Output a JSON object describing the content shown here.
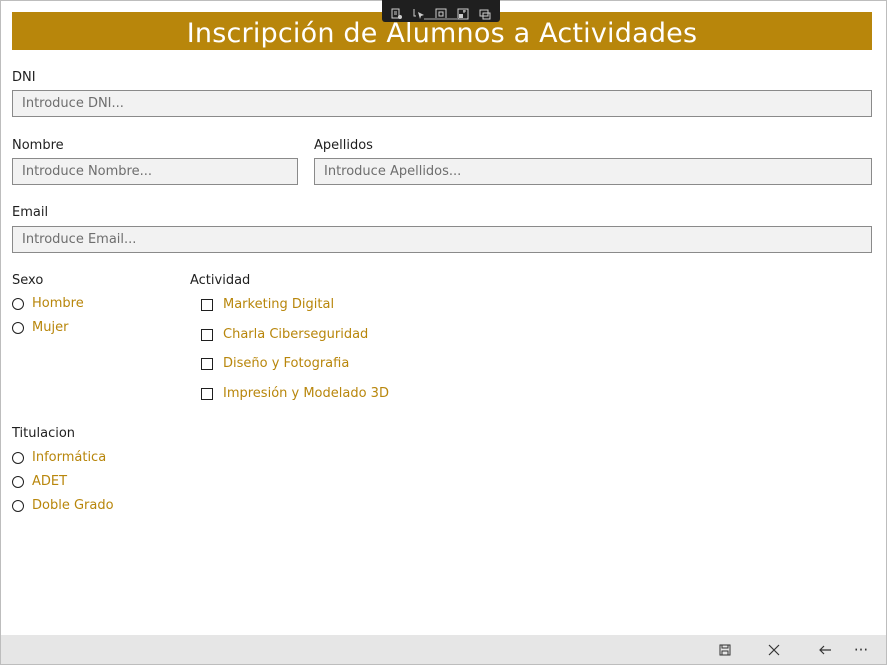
{
  "header": {
    "title": "Inscripción de Alumnos a Actividades"
  },
  "form": {
    "dni": {
      "label": "DNI",
      "placeholder": "Introduce DNI...",
      "value": ""
    },
    "nombre": {
      "label": "Nombre",
      "placeholder": "Introduce Nombre...",
      "value": ""
    },
    "apellidos": {
      "label": "Apellidos",
      "placeholder": "Introduce Apellidos...",
      "value": ""
    },
    "email": {
      "label": "Email",
      "placeholder": "Introduce Email...",
      "value": ""
    },
    "sexo": {
      "label": "Sexo",
      "options": [
        "Hombre",
        "Mujer"
      ]
    },
    "actividad": {
      "label": "Actividad",
      "options": [
        "Marketing Digital",
        "Charla Ciberseguridad",
        "Diseño y Fotografia",
        "Impresión y Modelado 3D"
      ]
    },
    "titulacion": {
      "label": "Titulacion",
      "options": [
        "Informática",
        "ADET",
        "Doble Grado"
      ]
    }
  },
  "colors": {
    "accent": "#b8860b",
    "input_bg": "#f2f2f2",
    "command_bar": "#e6e6e6"
  },
  "command_bar": {
    "icons": [
      "save-icon",
      "close-icon",
      "back-arrow-icon",
      "more-icon"
    ],
    "more_label": "···"
  },
  "debug_toolbar": {
    "icons": [
      "live-tree-icon",
      "select-element-icon",
      "display-layout-icon",
      "track-focus-icon",
      "binding-failures-icon"
    ]
  }
}
